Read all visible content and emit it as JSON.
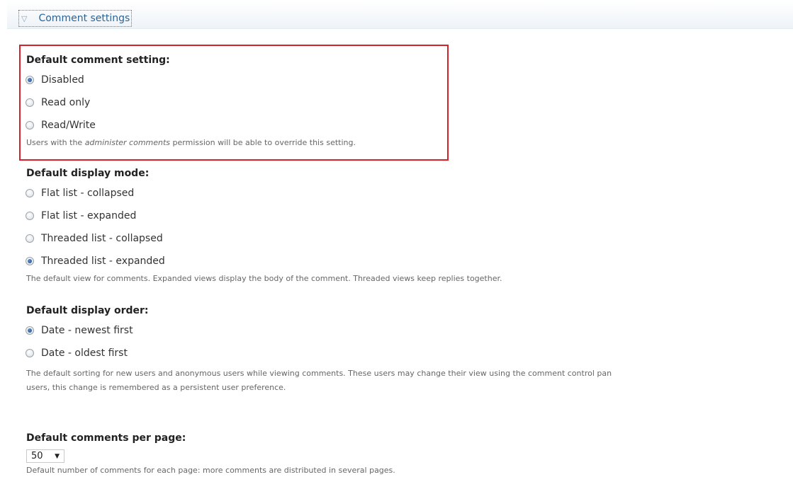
{
  "fieldset": {
    "title": "Comment settings",
    "toggle_glyph": "▽"
  },
  "default_comment": {
    "label": "Default comment setting:",
    "options": [
      "Disabled",
      "Read only",
      "Read/Write"
    ],
    "selected": 0,
    "desc_prefix": "Users with the ",
    "desc_em": "administer comments",
    "desc_suffix": " permission will be able to override this setting."
  },
  "display_mode": {
    "label": "Default display mode:",
    "options": [
      "Flat list - collapsed",
      "Flat list - expanded",
      "Threaded list - collapsed",
      "Threaded list - expanded"
    ],
    "selected": 3,
    "desc": "The default view for comments. Expanded views display the body of the comment. Threaded views keep replies together."
  },
  "display_order": {
    "label": "Default display order:",
    "options": [
      "Date - newest first",
      "Date - oldest first"
    ],
    "selected": 0,
    "desc_line1": "The default sorting for new users and anonymous users while viewing comments. These users may change their view using the comment control pan",
    "desc_line2": "users, this change is remembered as a persistent user preference."
  },
  "per_page": {
    "label": "Default comments per page:",
    "value": "50",
    "desc": "Default number of comments for each page: more comments are distributed in several pages."
  },
  "icons": {
    "collapse": "triangle-down-icon",
    "select_caret": "caret-down-icon"
  },
  "colors": {
    "highlight_border": "#d4222b",
    "link": "#2a6496",
    "radio_checked": "#1f4f8f"
  }
}
